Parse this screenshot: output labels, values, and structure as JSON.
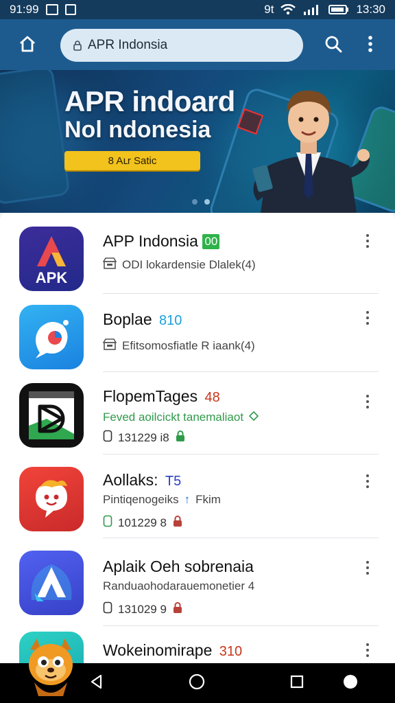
{
  "status_bar": {
    "time": "91:99",
    "carrier": "9t",
    "clock": "13:30"
  },
  "app_bar": {
    "search_text": "APR Indonsia",
    "icons": [
      "home-icon",
      "search-icon",
      "more-vert-icon"
    ]
  },
  "banner": {
    "title_line1": "APR indoard",
    "title_line2": "Nol ndonesia",
    "cta_label": "8 Aւr Satic",
    "pages": 2,
    "active_page": 2
  },
  "apps": [
    {
      "name": "APP Indonsia",
      "badge": "00",
      "badge_style": "box",
      "badge_color": "#2fb24a",
      "icon_text": "APK",
      "subtitle": "ODI lokardensie Dlalek(4)",
      "subtitle_icon": "storefront-icon",
      "meta": ""
    },
    {
      "name": "Boplae",
      "badge": "810",
      "badge_color": "#1aa0d8",
      "subtitle": "Efitsomosfiatle R iaank(4)",
      "subtitle_icon": "storefront-icon",
      "meta": ""
    },
    {
      "name": "FlopemTages",
      "badge": "48",
      "badge_color": "#c7361b",
      "subtitle": "Feved aoilcickt tanemaliaot",
      "subtitle_color": "#2f9a4a",
      "meta": "131229 i8",
      "meta_icon_color": "#2f9a4a"
    },
    {
      "name": "Aollaks:",
      "badge": "T5",
      "badge_color": "#2a3fbf",
      "subtitle": "Pintiqenogeiks",
      "subtitle_suffix": "Fkim",
      "meta": "101229 8",
      "meta_icon_color": "#c0392b"
    },
    {
      "name": "Aplaik Oeh sobrenaia",
      "badge": "",
      "subtitle": "Randuaohodarauemonetier 4",
      "meta": "131029 9",
      "meta_icon_color": "#c0392b"
    },
    {
      "name": "Wokeinomirape",
      "badge": "310",
      "badge_color": "#c7361b",
      "subtitle": "",
      "meta": ""
    }
  ],
  "nav_bar": {
    "icons": [
      "back-icon",
      "home-circle-icon",
      "recents-icon",
      "assistant-icon"
    ]
  }
}
